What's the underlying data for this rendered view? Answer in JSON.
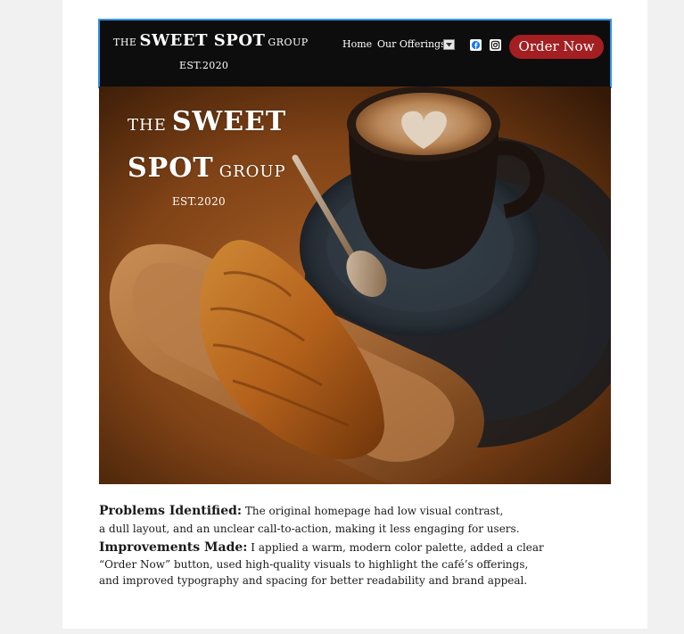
{
  "nav": {
    "logo_the": "THE",
    "logo_name": "SWEET SPOT",
    "logo_group": "GROUP",
    "logo_est": "EST.2020",
    "links": [
      "Home",
      "Our Offerings"
    ],
    "order_button": "Order Now",
    "icons": [
      "dropdown-caret-icon",
      "facebook-icon",
      "instagram-icon"
    ]
  },
  "hero": {
    "the": "THE",
    "sweet": "SWEET",
    "spot": "SPOT",
    "group": "GROUP",
    "est": "EST.2020",
    "image": "coffee cup with latte art and croissant on wooden tray"
  },
  "text": {
    "problems_label": "Problems Identified:",
    "problems_body_1": "The original homepage had low visual contrast,",
    "problems_body_2": "a dull layout, and an unclear call-to-action, making it less engaging for users.",
    "improvements_label": "Improvements  Made:",
    "improvements_body_1": "I applied a warm, modern color palette, added a clear",
    "improvements_body_2": "“Order Now” button, used high-quality visuals to highlight the café’s offerings,",
    "improvements_body_3": "and improved typography and spacing for better readability and brand appeal."
  },
  "colors": {
    "nav_bg": "#0d0d0d",
    "nav_border": "#2f94e8",
    "order_button": "#a31f22",
    "page_bg": "#f1f1f1"
  }
}
